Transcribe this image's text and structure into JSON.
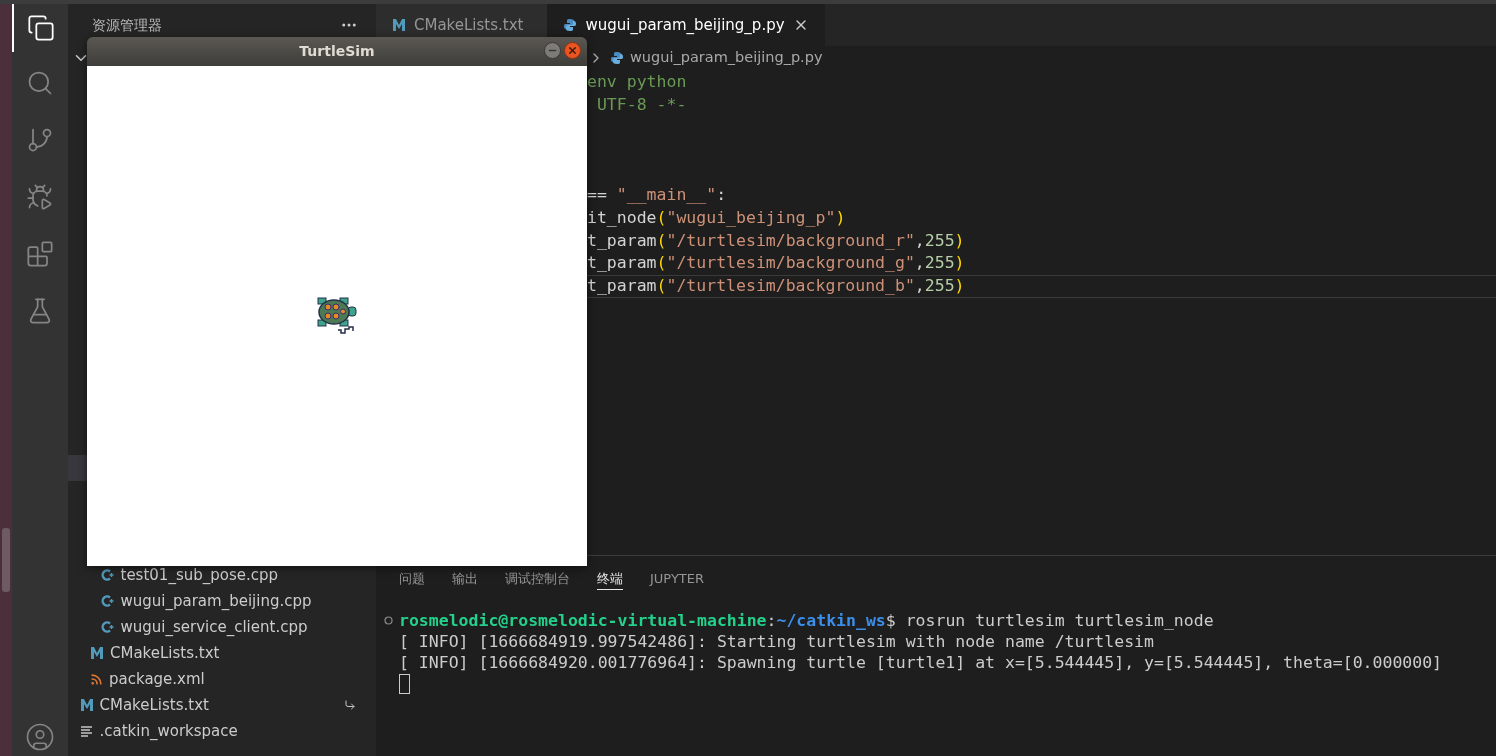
{
  "sidebar": {
    "title": "资源管理器",
    "tree": [
      {
        "children": [
          {
            "children": [
              {
                "label": "test01_sub_pose.cpp",
                "kind": "cpp"
              },
              {
                "label": "wugui_param_beijing.cpp",
                "kind": "cpp"
              },
              {
                "label": "wugui_service_client.cpp",
                "kind": "cpp"
              }
            ]
          },
          {
            "label": "CMakeLists.txt",
            "kind": "cmake"
          },
          {
            "label": "package.xml",
            "kind": "xml"
          }
        ]
      },
      {
        "label": "CMakeLists.txt",
        "kind": "cmake",
        "linked": true
      },
      {
        "label": ".catkin_workspace",
        "kind": "text"
      }
    ]
  },
  "tabs": [
    {
      "label": "CMakeLists.txt",
      "kind": "cmake",
      "selected": false
    },
    {
      "label": "wugui_param_beijing_p.py",
      "kind": "python",
      "selected": true
    }
  ],
  "breadcrumb": [
    "wugui_param_beijing_p.py"
  ],
  "code_lines": [
    {
      "kind": "code",
      "current": false,
      "tokens": [
        {
          "kind": "comment",
          "text": "env python"
        }
      ]
    },
    {
      "kind": "code",
      "current": false,
      "tokens": [
        {
          "kind": "comment",
          "text": " UTF-8 -*-"
        }
      ]
    },
    {
      "kind": "blank"
    },
    {
      "kind": "blank"
    },
    {
      "kind": "blank"
    },
    {
      "kind": "code",
      "current": false,
      "tokens": [
        {
          "kind": "plain",
          "text": "== "
        },
        {
          "kind": "string",
          "text": "\"__main__\""
        },
        {
          "kind": "plain",
          "text": ":"
        }
      ]
    },
    {
      "kind": "code",
      "current": false,
      "tokens": [
        {
          "kind": "plain",
          "text": "it_node"
        },
        {
          "kind": "paren",
          "text": "("
        },
        {
          "kind": "string",
          "text": "\"wugui_beijing_p\""
        },
        {
          "kind": "paren",
          "text": ")"
        }
      ]
    },
    {
      "kind": "code",
      "current": false,
      "tokens": [
        {
          "kind": "plain",
          "text": "t_param"
        },
        {
          "kind": "paren",
          "text": "("
        },
        {
          "kind": "string",
          "text": "\"/turtlesim/background_r\""
        },
        {
          "kind": "plain",
          "text": ","
        },
        {
          "kind": "number",
          "text": "255"
        },
        {
          "kind": "paren",
          "text": ")"
        }
      ]
    },
    {
      "kind": "code",
      "current": false,
      "tokens": [
        {
          "kind": "plain",
          "text": "t_param"
        },
        {
          "kind": "paren",
          "text": "("
        },
        {
          "kind": "string",
          "text": "\"/turtlesim/background_g\""
        },
        {
          "kind": "plain",
          "text": ","
        },
        {
          "kind": "number",
          "text": "255"
        },
        {
          "kind": "paren",
          "text": ")"
        }
      ]
    },
    {
      "kind": "code",
      "current": true,
      "tokens": [
        {
          "kind": "plain",
          "text": "t_param"
        },
        {
          "kind": "paren",
          "text": "("
        },
        {
          "kind": "string",
          "text": "\"/turtlesim/background_b\""
        },
        {
          "kind": "plain",
          "text": ","
        },
        {
          "kind": "number",
          "text": "255"
        },
        {
          "kind": "paren",
          "text": ")"
        }
      ]
    }
  ],
  "panel": {
    "tabs": [
      {
        "label": "问题",
        "selected": false
      },
      {
        "label": "输出",
        "selected": false
      },
      {
        "label": "调试控制台",
        "selected": false
      },
      {
        "label": "终端",
        "selected": true
      },
      {
        "label": "JUPYTER",
        "selected": false
      }
    ],
    "terminal": {
      "prompt_user": "rosmelodic@rosmelodic-virtual-machine",
      "prompt_sep": ":",
      "prompt_path": "~/catkin_ws",
      "prompt_command": "$ rosrun turtlesim turtlesim_node",
      "output": [
        "[ INFO] [1666684919.997542486]: Starting turtlesim with node name /turtlesim",
        "[ INFO] [1666684920.001776964]: Spawning turtle [turtle1] at x=[5.544445], y=[5.544445], theta=[0.000000]"
      ]
    }
  },
  "turtlesim": {
    "title": "TurtleSim"
  }
}
